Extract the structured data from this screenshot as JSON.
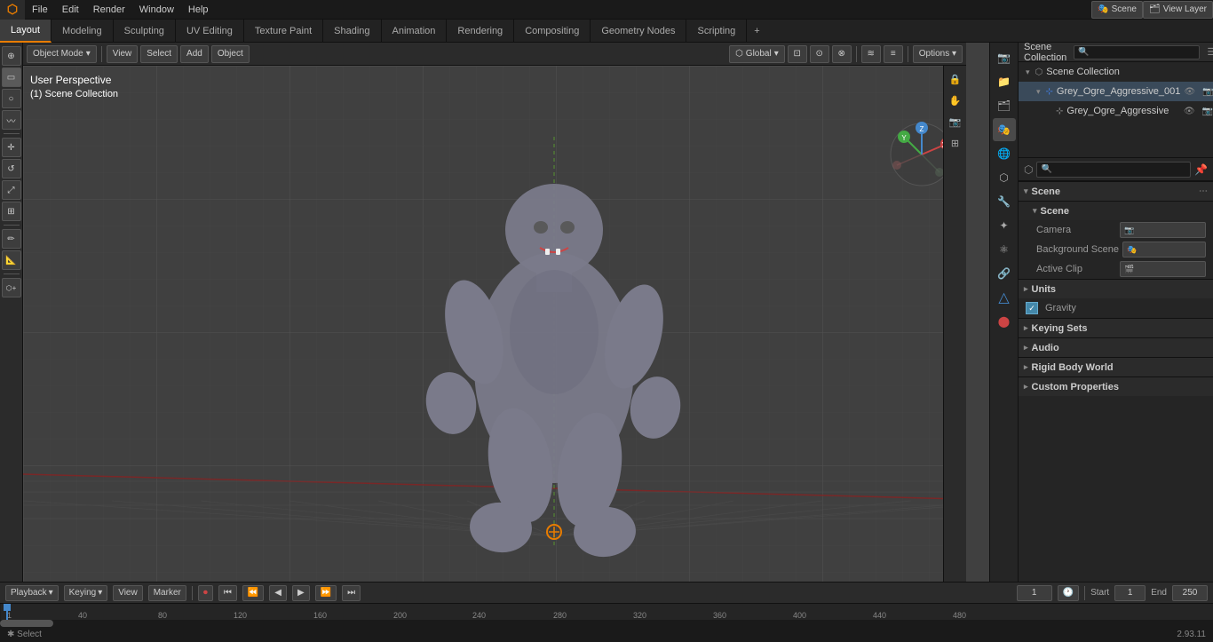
{
  "app": {
    "title": "Blender",
    "version": "2.93.11"
  },
  "top_menu": {
    "items": [
      "File",
      "Edit",
      "Render",
      "Window",
      "Help"
    ]
  },
  "workspace_tabs": {
    "tabs": [
      "Layout",
      "Modeling",
      "Sculpting",
      "UV Editing",
      "Texture Paint",
      "Shading",
      "Animation",
      "Rendering",
      "Compositing",
      "Geometry Nodes",
      "Scripting"
    ],
    "active": "Layout"
  },
  "viewport": {
    "mode": "Object Mode",
    "view_label": "View",
    "select_label": "Select",
    "add_label": "Add",
    "object_label": "Object",
    "transform": "Global",
    "snap_label": "Options",
    "view_info_line1": "User Perspective",
    "view_info_line2": "(1) Scene Collection"
  },
  "gizmo": {
    "x_color": "#ff4444",
    "y_color": "#88cc44",
    "z_color": "#4488ff"
  },
  "outliner": {
    "title": "Scene Collection",
    "items": [
      {
        "label": "Scene Collection",
        "icon": "collection",
        "indent": 0
      },
      {
        "label": "Grey_Ogre_Aggressive_001",
        "icon": "armature",
        "indent": 1,
        "selected": true
      },
      {
        "label": "Grey_Ogre_Aggressive",
        "icon": "mesh",
        "indent": 2
      }
    ]
  },
  "properties": {
    "active_tab": "scene",
    "scene_header": "Scene",
    "scene_label": "Scene",
    "properties_header": {
      "title": "Scene",
      "subtitle": "Scene"
    },
    "camera": {
      "label": "Camera",
      "value": ""
    },
    "background_scene": {
      "label": "Background Scene",
      "value": ""
    },
    "active_clip": {
      "label": "Active Clip",
      "value": ""
    },
    "units": {
      "label": "Units",
      "collapsed": true
    },
    "gravity": {
      "label": "Gravity",
      "enabled": true
    },
    "keying_sets": {
      "label": "Keying Sets",
      "collapsed": true
    },
    "audio": {
      "label": "Audio",
      "collapsed": true
    },
    "rigid_body_world": {
      "label": "Rigid Body World",
      "collapsed": true
    },
    "custom_properties": {
      "label": "Custom Properties",
      "collapsed": true
    }
  },
  "timeline": {
    "playback_label": "Playback",
    "keying_label": "Keying",
    "view_label": "View",
    "marker_label": "Marker",
    "frame_current": "1",
    "start_label": "Start",
    "start_value": "1",
    "end_label": "End",
    "end_value": "250",
    "frame_markers": [
      "1",
      "40",
      "80",
      "120",
      "160",
      "200",
      "240"
    ]
  },
  "status_bar": {
    "select_label": "Select",
    "version": "2.93.11"
  },
  "icons": {
    "arrow_right": "▶",
    "arrow_down": "▼",
    "cursor": "⊕",
    "move": "✛",
    "rotate": "↺",
    "scale": "⤢",
    "transform": "⊞",
    "annotate": "✏",
    "measure": "📐",
    "eye": "👁",
    "camera": "📷",
    "render": "🎬",
    "scene": "🎭",
    "world": "🌍",
    "object": "⬡",
    "modifier": "🔧",
    "particles": "✦",
    "physics": "⚛",
    "constraints": "🔗",
    "data": "▽",
    "material": "⬤",
    "chevron_down": "▾",
    "chevron_right": "▸",
    "add": "+"
  },
  "prop_icons": {
    "render": "📷",
    "output": "📁",
    "view_layer": "🗂",
    "scene": "🎭",
    "world": "🌐",
    "object": "⬡",
    "modifier": "🔧",
    "particles": "✦",
    "physics": "⚛",
    "constraints": "🔗",
    "object_data": "△",
    "material": "⬤"
  }
}
